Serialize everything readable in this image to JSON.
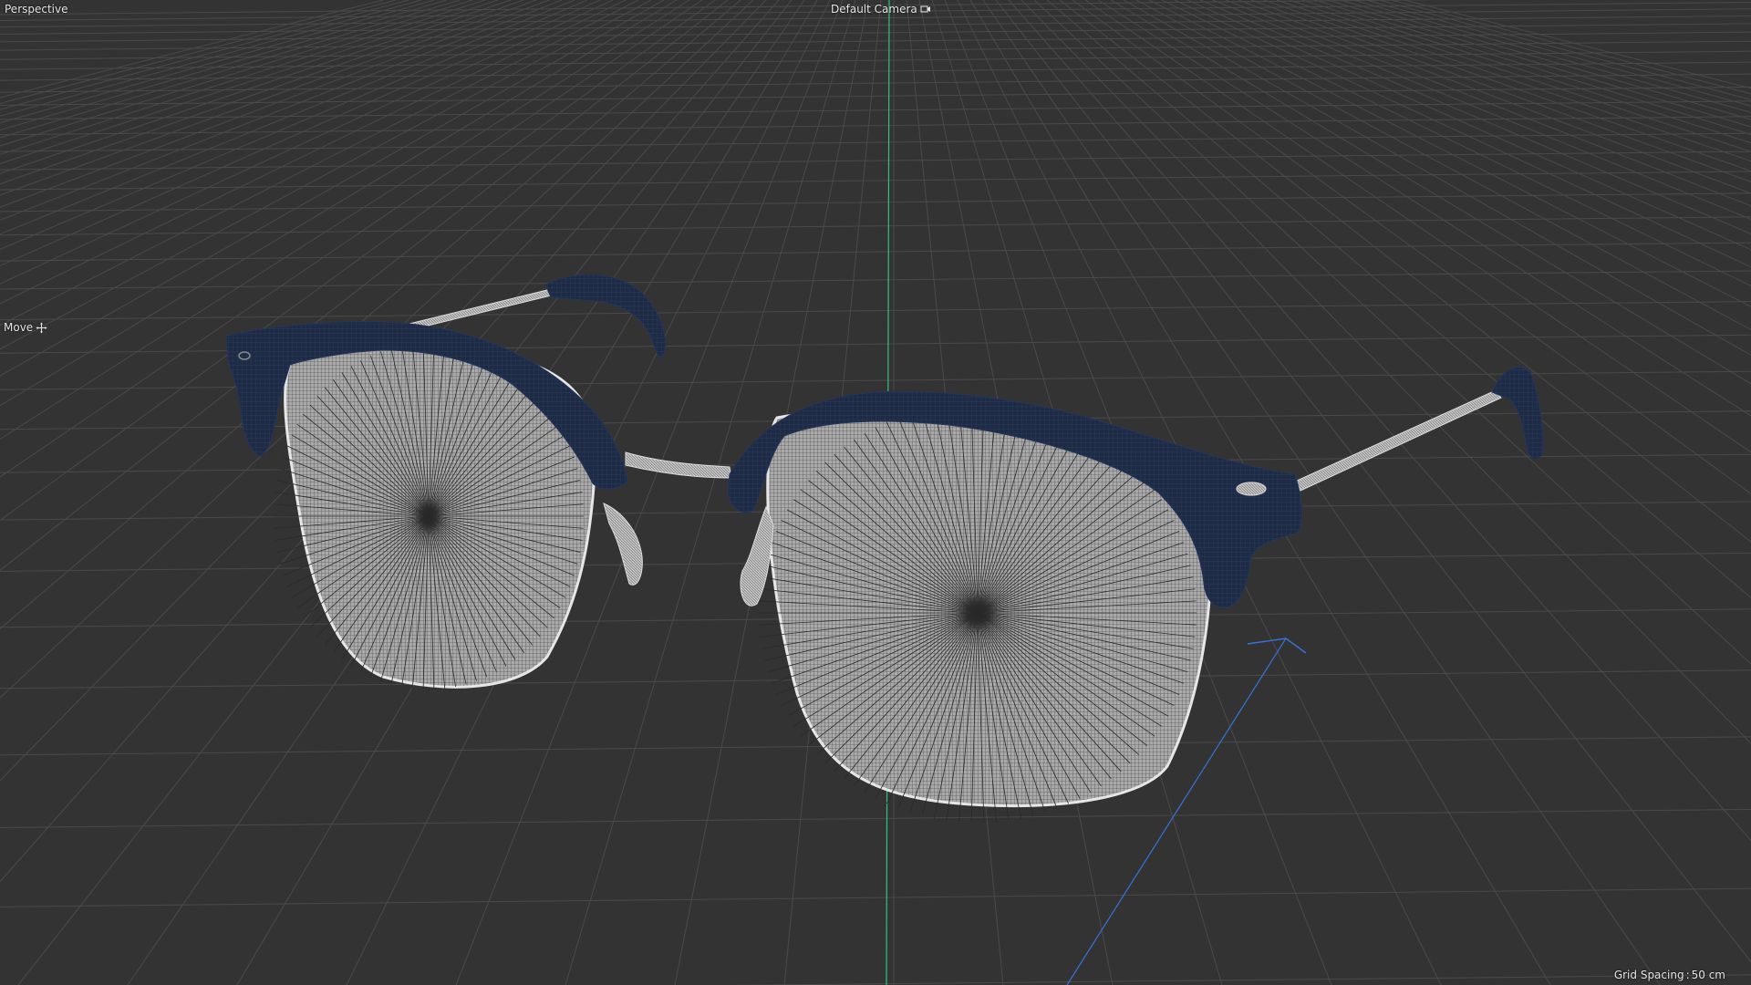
{
  "viewport": {
    "view_name": "Perspective",
    "camera_name": "Default Camera",
    "camera_icon": "camera-icon",
    "active_tool": "Move",
    "tool_icon": "move-icon",
    "grid_spacing_label": "Grid Spacing",
    "grid_spacing_value": "50 cm",
    "background_color": "#333333",
    "grid_line_color": "#4a4a4a",
    "y_axis_color": "#33c27a",
    "z_axis_color": "#3a73d6"
  },
  "model": {
    "object": "glasses",
    "frame_top_color": "#1e2b45",
    "wireframe_color": "#d8d8d8",
    "lens_fill_color": "#b4b4b4"
  }
}
